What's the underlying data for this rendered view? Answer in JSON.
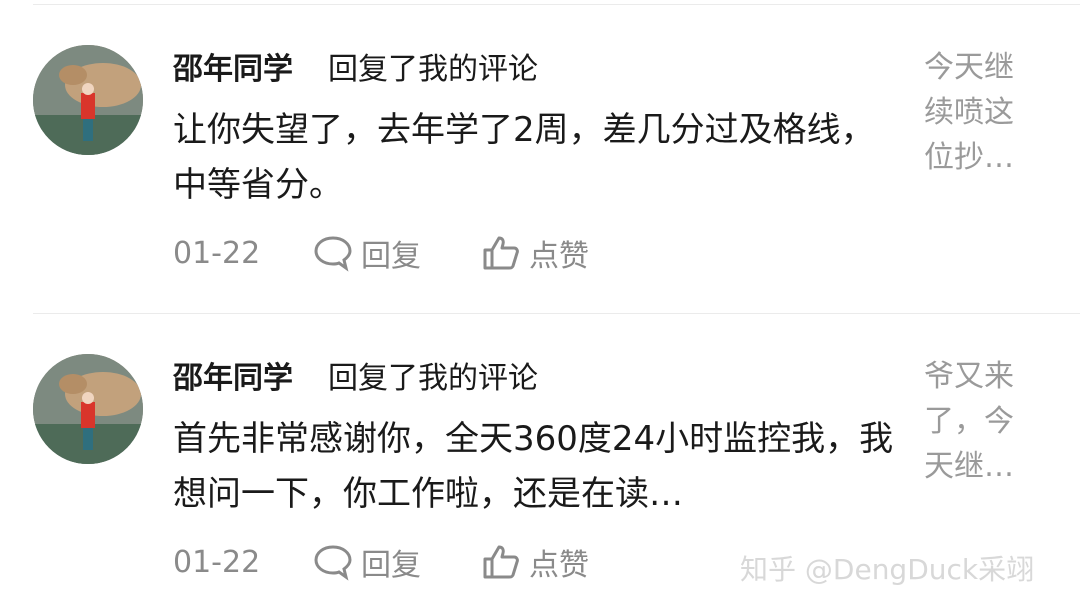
{
  "comments": [
    {
      "user": "邵年同学",
      "action": "回复了我的评论",
      "content": "让你失望了，去年学了2周，差几分过及格线，中等省分。",
      "quote": "今天继续喷这位抄…",
      "date": "01-22",
      "reply_label": "回复",
      "like_label": "点赞"
    },
    {
      "user": "邵年同学",
      "action": "回复了我的评论",
      "content": "首先非常感谢你，全天360度24小时监控我，我想问一下，你工作啦，还是在读…",
      "quote": "爷又来了，今天继…",
      "date": "01-22",
      "reply_label": "回复",
      "like_label": "点赞"
    }
  ],
  "watermark": "知乎 @DengDuck采翊",
  "colors": {
    "text": "#1a1a1a",
    "muted": "#8a8a8a",
    "quote": "#9a9a9a"
  }
}
